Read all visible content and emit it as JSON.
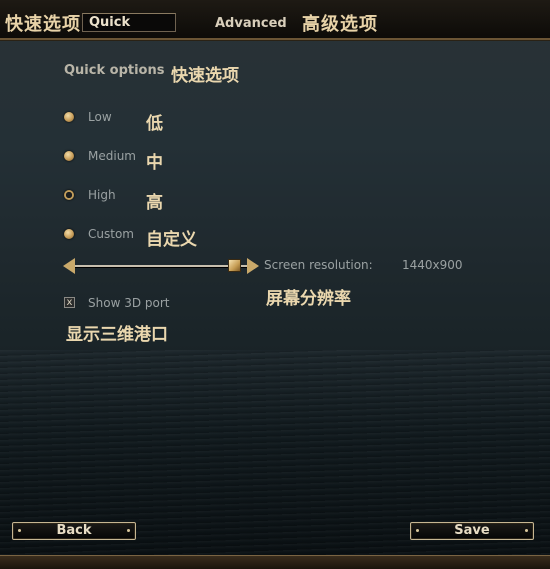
{
  "topbar": {
    "quick_cn": "快速选项",
    "quick_tab": "Quick",
    "advanced_tab": "Advanced",
    "advanced_cn": "高级选项"
  },
  "section": {
    "title_en": "Quick options",
    "title_cn": "快速选项"
  },
  "options": [
    {
      "label_en": "Low",
      "label_cn": "低",
      "selected": false
    },
    {
      "label_en": "Medium",
      "label_cn": "中",
      "selected": false
    },
    {
      "label_en": "High",
      "label_cn": "高",
      "selected": true
    },
    {
      "label_en": "Custom",
      "label_cn": "自定义",
      "selected": false
    }
  ],
  "resolution": {
    "label_en": "Screen resolution:",
    "value": "1440x900",
    "label_cn": "屏幕分辨率"
  },
  "show3d": {
    "label_en": "Show 3D port",
    "label_cn": "显示三维港口",
    "checked": true,
    "mark": "x"
  },
  "buttons": {
    "back": "Back",
    "save": "Save"
  },
  "colors": {
    "accent": "#c9a96a",
    "cn_label": "#ead7ae",
    "en_label": "#9aa1a2"
  }
}
